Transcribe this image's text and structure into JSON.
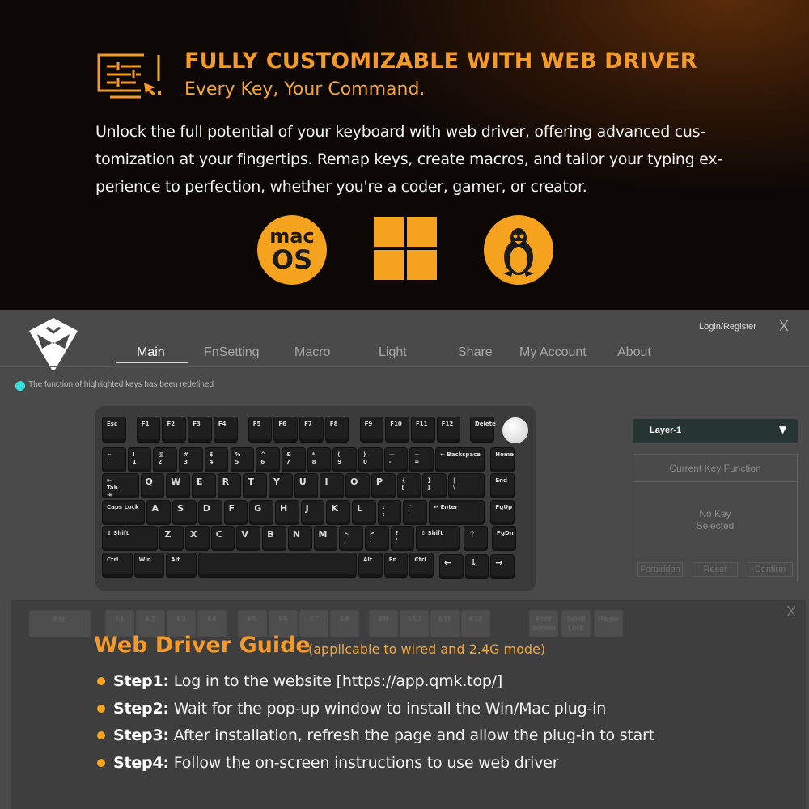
{
  "hero": {
    "title": "FULLY CUSTOMIZABLE WITH WEB DRIVER",
    "subtitle": "Every Key, Your Command.",
    "body": "Unlock the full potential of your keyboard with web driver, offering advanced cus-tomization at your fingertips. Remap keys, create macros, and tailor your typing ex-perience to perfection, whether you're a coder, gamer, or creator.",
    "os_icons": [
      "macos-icon",
      "windows-icon",
      "linux-icon"
    ],
    "macos_text": [
      "mac",
      "OS"
    ],
    "accent": "#f5a21f"
  },
  "app": {
    "login": "Login/Register",
    "close": "X",
    "tabs": [
      "Main",
      "FnSetting",
      "Macro",
      "Light",
      "Share",
      "My Account",
      "About"
    ],
    "active_tab": "Main",
    "notice": "The function of highlighted keys has been redefined",
    "notice_color": "#36e0d8",
    "layer_select": "Layer-1",
    "panel": {
      "title": "Current Key Function",
      "empty": "No Key\nSelected",
      "buttons": [
        "Forbidden",
        "Reset",
        "Confirm"
      ]
    },
    "keyboard": {
      "rows": [
        [
          "Esc",
          "F1",
          "F2",
          "F3",
          "F4",
          "F5",
          "F6",
          "F7",
          "F8",
          "F9",
          "F10",
          "F11",
          "F12",
          "Delete"
        ],
        [
          "~\n`",
          "!\n1",
          "@\n2",
          "#\n3",
          "$\n4",
          "%\n5",
          "^\n6",
          "&\n7",
          "*\n8",
          "(\n9",
          ")\n0",
          "—\n-",
          "+\n=",
          "← Backspace",
          "Home"
        ],
        [
          "⇤\nTab\n⇥",
          "Q",
          "W",
          "E",
          "R",
          "T",
          "Y",
          "U",
          "I",
          "O",
          "P",
          "{\n[",
          "}\n]",
          "|\n\\",
          "End"
        ],
        [
          "Caps Lock",
          "A",
          "S",
          "D",
          "F",
          "G",
          "H",
          "J",
          "K",
          "L",
          ":\n;",
          "\"\n'",
          "↵ Enter",
          "PgUp"
        ],
        [
          "⇧ Shift",
          "Z",
          "X",
          "C",
          "V",
          "B",
          "N",
          "M",
          "<\n,",
          ">\n.",
          "?\n/",
          "⇧ Shift",
          "↑",
          "PgDn"
        ],
        [
          "Ctrl",
          "Win",
          "Alt",
          "",
          "Alt",
          "Fn",
          "Ctrl",
          "←",
          "↓",
          "→"
        ]
      ]
    }
  },
  "guide": {
    "title": "Web Driver Guide",
    "note": "(applicable to wired and 2.4G mode)",
    "close": "X",
    "background_keys": [
      "Esc",
      "F1",
      "F2",
      "F3",
      "F4",
      "F5",
      "F6",
      "F7",
      "F8",
      "F9",
      "F10",
      "F11",
      "F12",
      "Print\nScreen",
      "Scroll\nLock",
      "Pause"
    ],
    "steps": [
      {
        "label": "Step1:",
        "text": "Log in to the website [https://app.qmk.top/]"
      },
      {
        "label": "Step2:",
        "text": "Wait for the pop-up window to install the Win/Mac plug-in"
      },
      {
        "label": "Step3:",
        "text": "After installation, refresh the page and allow the plug-in to start"
      },
      {
        "label": "Step4:",
        "text": "Follow the on-screen instructions to use web driver"
      }
    ]
  }
}
